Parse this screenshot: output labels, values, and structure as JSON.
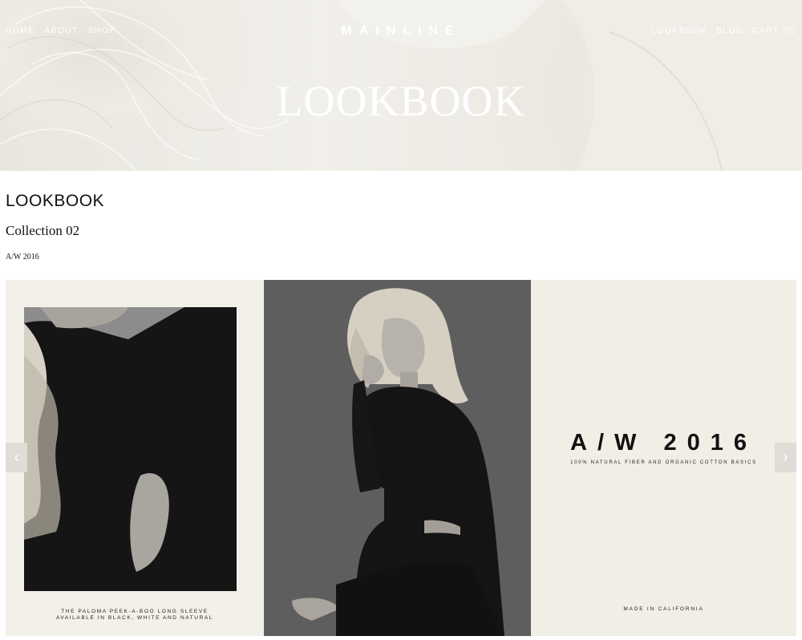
{
  "nav": {
    "left": [
      "HOME",
      "ABOUT",
      "SHOP"
    ],
    "right": [
      "LOOKBOOK",
      "BLOG",
      "CART (0)"
    ]
  },
  "brand": "MAINLINE",
  "hero": {
    "title": "LOOKBOOK"
  },
  "page": {
    "title": "LOOKBOOK",
    "collection": "Collection 02",
    "season": "A/W 2016"
  },
  "gallery": {
    "slide1": {
      "caption_line1": "THE PALOMA PEEK-A-BOO LONG SLEEVE",
      "caption_line2": "AVAILABLE IN BLACK, WHITE AND NATURAL"
    },
    "slide3": {
      "title": "A/W 2016",
      "subtitle": "100% NATURAL FIBER AND ORGANIC COTTON BASICS",
      "footer": "MADE IN CALIFORNIA"
    },
    "prev_icon": "chevron-left-icon",
    "next_icon": "chevron-right-icon"
  },
  "colors": {
    "hero_bg": "#ece9e2",
    "panel_cream": "#f3f0ea",
    "panel_grey": "#5d5d5d",
    "text": "#111111"
  }
}
